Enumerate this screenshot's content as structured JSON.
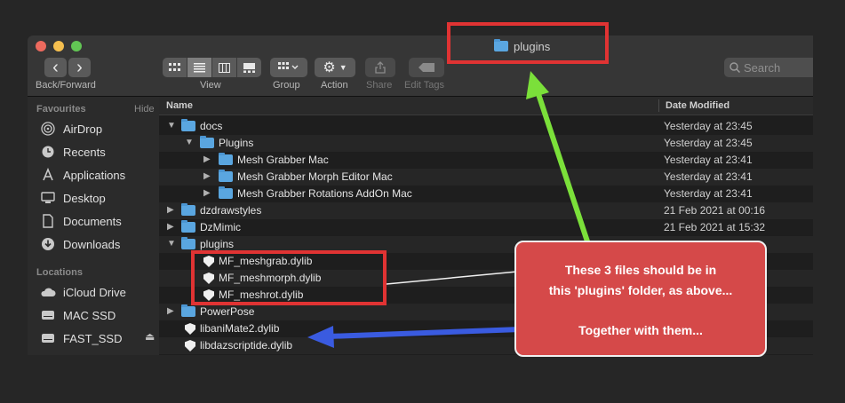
{
  "window": {
    "title": "plugins"
  },
  "toolbar": {
    "back_label": "‹",
    "forward_label": "›",
    "back_forward_label": "Back/Forward",
    "view_label": "View",
    "group_label": "Group",
    "action_label": "Action",
    "share_label": "Share",
    "edit_tags_label": "Edit Tags",
    "search_placeholder": "Search"
  },
  "sidebar": {
    "favourites_header": "Favourites",
    "hide_label": "Hide",
    "favourites": [
      {
        "label": "AirDrop",
        "icon": "airdrop-icon"
      },
      {
        "label": "Recents",
        "icon": "clock-icon"
      },
      {
        "label": "Applications",
        "icon": "applications-icon"
      },
      {
        "label": "Desktop",
        "icon": "desktop-icon"
      },
      {
        "label": "Documents",
        "icon": "document-icon"
      },
      {
        "label": "Downloads",
        "icon": "download-icon"
      }
    ],
    "locations_header": "Locations",
    "locations": [
      {
        "label": "iCloud Drive",
        "icon": "cloud-icon"
      },
      {
        "label": "MAC SSD",
        "icon": "disk-icon"
      },
      {
        "label": "FAST_SSD",
        "icon": "disk-icon",
        "eject": "⏏"
      }
    ]
  },
  "file_list": {
    "columns": {
      "name": "Name",
      "date": "Date Modified"
    },
    "rows": [
      {
        "name": "docs",
        "date": "Yesterday at 23:45",
        "kind": "folder",
        "expanded": true
      },
      {
        "name": "Plugins",
        "date": "Yesterday at 23:45",
        "kind": "folder",
        "expanded": true
      },
      {
        "name": "Mesh Grabber Mac",
        "date": "Yesterday at 23:41",
        "kind": "folder",
        "expanded": false
      },
      {
        "name": "Mesh Grabber Morph Editor Mac",
        "date": "Yesterday at 23:41",
        "kind": "folder",
        "expanded": false
      },
      {
        "name": "Mesh Grabber Rotations AddOn Mac",
        "date": "Yesterday at 23:41",
        "kind": "folder",
        "expanded": false
      },
      {
        "name": "dzdrawstyles",
        "date": "21 Feb 2021 at 00:16",
        "kind": "folder",
        "expanded": false
      },
      {
        "name": "DzMimic",
        "date": "21 Feb 2021 at 15:32",
        "kind": "folder",
        "expanded": false
      },
      {
        "name": "plugins",
        "date": "",
        "kind": "folder",
        "expanded": true
      },
      {
        "name": "MF_meshgrab.dylib",
        "date": "",
        "kind": "dylib"
      },
      {
        "name": "MF_meshmorph.dylib",
        "date": "",
        "kind": "dylib"
      },
      {
        "name": "MF_meshrot.dylib",
        "date": "",
        "kind": "dylib"
      },
      {
        "name": "PowerPose",
        "date": "",
        "kind": "folder",
        "expanded": false
      },
      {
        "name": "libaniMate2.dylib",
        "date": "",
        "kind": "dylib"
      },
      {
        "name": "libdazscriptide.dylib",
        "date": "",
        "kind": "dylib"
      }
    ]
  },
  "annotation": {
    "line1": "These 3 files should be in",
    "line2": "this 'plugins' folder, as above...",
    "line3": "Together with them...",
    "box_color": "#e03333",
    "callout_color": "#d54949",
    "green_arrow_color": "#7be03a",
    "blue_arrow_color": "#3a5be0"
  }
}
